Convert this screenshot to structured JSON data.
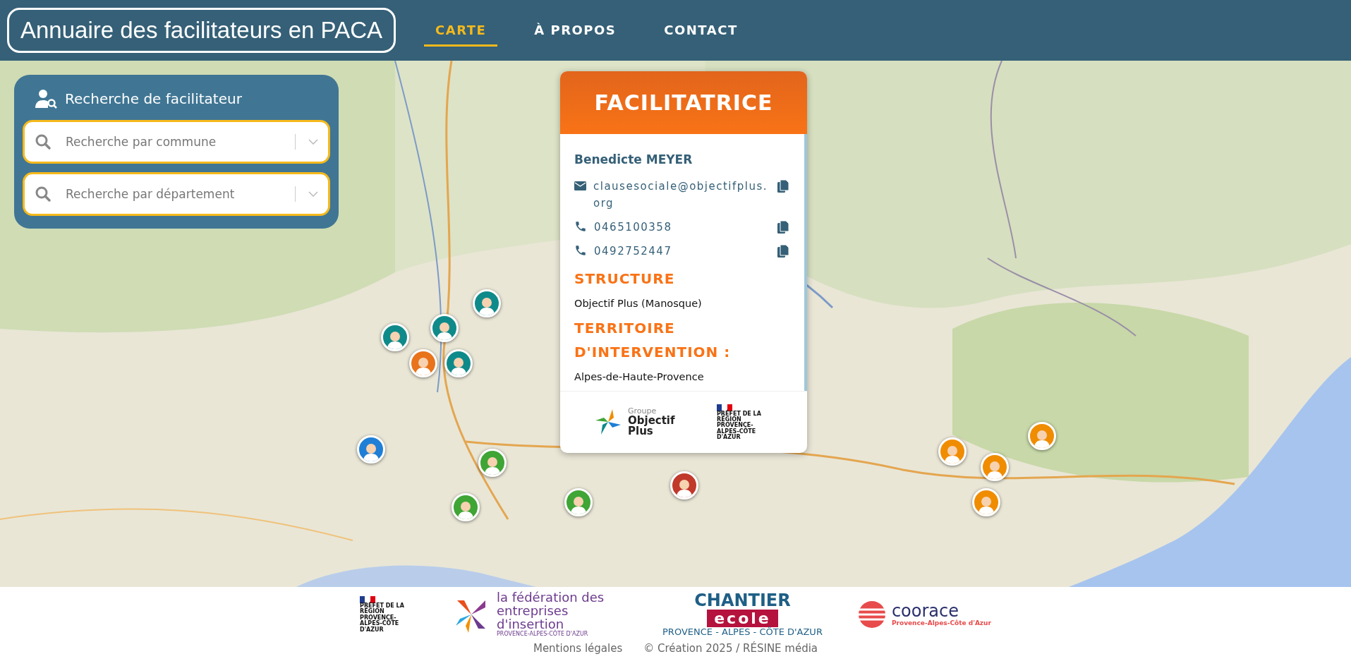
{
  "header": {
    "title": "Annuaire des facilitateurs en PACA",
    "nav": [
      {
        "label": "CARTE",
        "selected": true
      },
      {
        "label": "À PROPOS",
        "selected": false
      },
      {
        "label": "CONTACT",
        "selected": false
      }
    ]
  },
  "search_panel": {
    "title": "Recherche de facilitateur",
    "fields": [
      {
        "placeholder": "Recherche par commune"
      },
      {
        "placeholder": "Recherche par département"
      }
    ]
  },
  "map": {
    "kind": "picture",
    "markers": [
      {
        "color": "#0f8a8a"
      },
      {
        "color": "#0f8a8a"
      },
      {
        "color": "#e8731a"
      },
      {
        "color": "#0f8a8a"
      },
      {
        "color": "#0f8a8a"
      },
      {
        "color": "#1f7fd6"
      },
      {
        "color": "#3fa535"
      },
      {
        "color": "#3fa535"
      },
      {
        "color": "#3fa535"
      },
      {
        "color": "#c0392b"
      },
      {
        "color": "#f08c00"
      },
      {
        "color": "#f08c00"
      },
      {
        "color": "#f08c00"
      },
      {
        "color": "#f08c00"
      }
    ]
  },
  "popup": {
    "title": "FACILITATRICE",
    "name": "Benedicte MEYER",
    "contacts": [
      {
        "kind": "email",
        "value": "clausesociale@objectifplus.org"
      },
      {
        "kind": "phone",
        "value": "0465100358"
      },
      {
        "kind": "phone",
        "value": "0492752447"
      }
    ],
    "structure_heading": "STRUCTURE",
    "structure": "Objectif Plus (Manosque)",
    "territory_heading": "TERRITOIRE D'INTERVENTION :",
    "territory": "Alpes-de-Haute-Provence",
    "logos": [
      {
        "kind": "objectif",
        "top": "Groupe",
        "main": "Objectif Plus"
      },
      {
        "kind": "prefet",
        "main": "PRÉFET DE LA RÉGION PROVENCE-ALPES-CÔTE D'AZUR"
      }
    ]
  },
  "footer": {
    "logos": [
      {
        "kind": "prefet",
        "main": "PRÉFET DE LA RÉGION PROVENCE-ALPES-CÔTE D'AZUR"
      },
      {
        "kind": "federation",
        "main": "la fédération des entreprises d'insertion",
        "sub": "PROVENCE-ALPES-CÔTE D'AZUR"
      },
      {
        "kind": "chantier",
        "main": "CHANTIER",
        "band": "ecole",
        "sub": "PROVENCE - ALPES - CÔTE D'AZUR"
      },
      {
        "kind": "coorace",
        "main": "coorace",
        "sub": "Provence-Alpes-Côte d'Azur"
      }
    ],
    "links": [
      "Mentions légales",
      "© Création 2025 / RÉSINE média"
    ]
  }
}
